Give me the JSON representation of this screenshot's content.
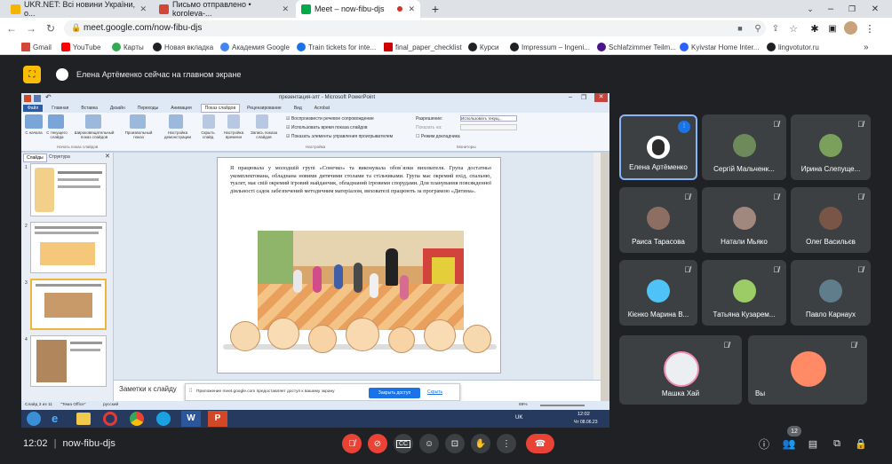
{
  "browser": {
    "tabs": [
      {
        "label": "UKR.NET: Всі новини України, о...",
        "fav_color": "#f5b400"
      },
      {
        "label": "Письмо отправлено • koroleva-...",
        "fav_color": "#d14836"
      },
      {
        "label": "Meet – now-fibu-djs",
        "fav_color": "#00ac47"
      }
    ],
    "url": "meet.google.com/now-fibu-djs",
    "bookmarks": [
      {
        "label": "Gmail",
        "color": "#d14836"
      },
      {
        "label": "YouTube",
        "color": "#ff0000"
      },
      {
        "label": "Карты",
        "color": "#34a853"
      },
      {
        "label": "Новая вкладка",
        "color": "#202124"
      },
      {
        "label": "Академия Google",
        "color": "#4285f4"
      },
      {
        "label": "Train tickets for inte...",
        "color": "#1a73e8"
      },
      {
        "label": "final_paper_checklist",
        "color": "#c00"
      },
      {
        "label": "Курси",
        "color": "#202124"
      },
      {
        "label": "Impressum – Ingeni...",
        "color": "#202124"
      },
      {
        "label": "Schlafzimmer Teilm...",
        "color": "#4a148c"
      },
      {
        "label": "Kyivstar Home Inter...",
        "color": "#2962ff"
      },
      {
        "label": "lingvotutor.ru",
        "color": "#202124"
      }
    ]
  },
  "meet": {
    "presenter_banner": "Елена Артёменко сейчас на главном экране",
    "meeting_time": "12:02",
    "meeting_code": "now-fibu-djs",
    "participants_count": "12",
    "participants": [
      {
        "name": "Елена Артёменко",
        "color": "#5f6368",
        "active": true
      },
      {
        "name": "Сергій Мальченк...",
        "color": "#6d8b5a"
      },
      {
        "name": "Ирина Слепуще...",
        "color": "#7ba05b"
      },
      {
        "name": "Раиса Тарасова",
        "color": "#8d6e63"
      },
      {
        "name": "Натали Мьяко",
        "color": "#a1887f"
      },
      {
        "name": "Олег Васильєв",
        "color": "#795548"
      },
      {
        "name": "Кієнко Марина В...",
        "color": "#4fc3f7"
      },
      {
        "name": "Татьяна Кузарем...",
        "color": "#9ccc65"
      },
      {
        "name": "Павло Карнаух",
        "color": "#607d8b"
      }
    ],
    "bottom_row": [
      {
        "name": "Машка Хай",
        "color": "#eceff1"
      },
      {
        "name": "Вы",
        "color": "#ff8a65"
      }
    ]
  },
  "ppt": {
    "window_title": "презентация-злт - Microsoft PowerPoint",
    "ribbon_tabs": [
      "Файл",
      "Главная",
      "Вставка",
      "Дизайн",
      "Переходы",
      "Анимация",
      "Показ слайдов",
      "Рецензирование",
      "Вид",
      "Acrobat"
    ],
    "ribbon_buttons": [
      "С начала",
      "С текущего слайда",
      "Широковещательный показ слайдов",
      "Произвольный показ",
      "Настройка демонстрации",
      "Скрыть слайд",
      "Настройка времени",
      "Запись показа слайдов"
    ],
    "ribbon_checks": [
      "Воспроизвести речевое сопровождение",
      "Использовать время показа слайдов",
      "Показать элементы управления проигрывателем"
    ],
    "ribbon_monitor": [
      "Разрешение:",
      "Использовать текущ...",
      "Показать на:",
      "Режим докладчика"
    ],
    "ribbon_groups": [
      "Начать показ слайдов",
      "Настройка",
      "Мониторы"
    ],
    "panel_tabs": [
      "Слайды",
      "Структура"
    ],
    "slide_text": "Я працювала у молодшій групі «Сонечко» та виконувала обов`язки вихователя. Група достатньо укомплектована, обладнана новими дитячими столами та стільчиками. Група має окремий вхід, спальню, туалет, має свій окремий ігровий майданчик, обладнаний ігровими спорудами. Для планування повсякденної діяльності садок забезпечений методичним матеріалом, вихователі працюють за програмою «Дитина».",
    "notes_label": "Заметки к слайду",
    "status": [
      "Слайд 3 из 11",
      "\"Тема Office\"",
      "русский"
    ],
    "zoom": "69%",
    "share_notice": "Приложение meet.google.com предоставляет доступ к вашему экрану",
    "share_close": "Закрыть доступ",
    "share_hide": "Скрыть",
    "taskbar_lang": "UK",
    "taskbar_time": "12:02",
    "taskbar_date": "Чт 08.06.23"
  }
}
